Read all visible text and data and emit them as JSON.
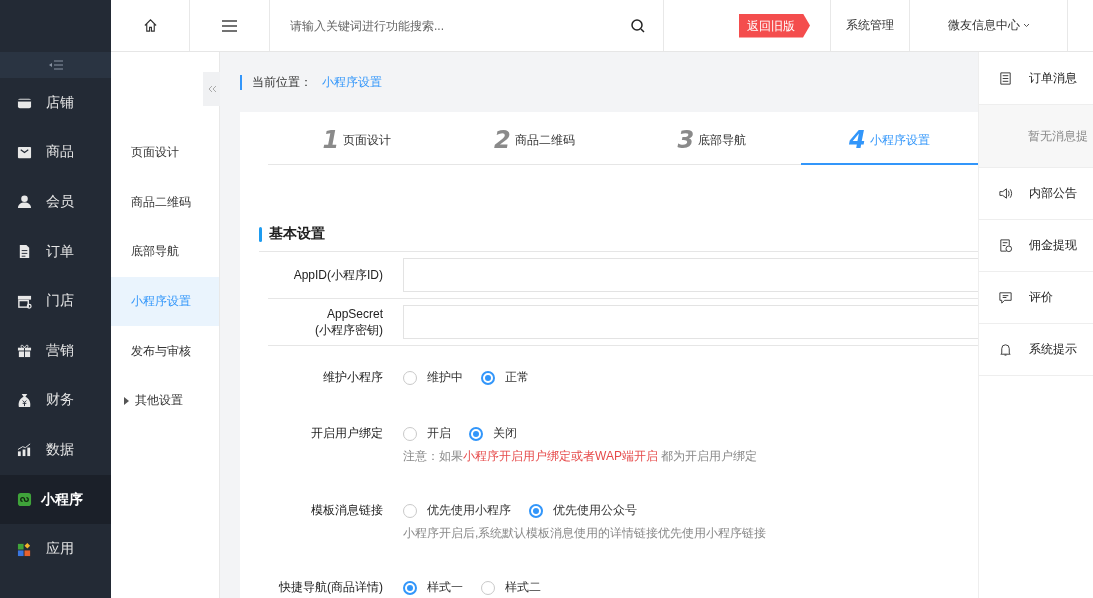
{
  "sidebar": {
    "items": [
      {
        "label": "店铺",
        "selected": false
      },
      {
        "label": "商品",
        "selected": false
      },
      {
        "label": "会员",
        "selected": false
      },
      {
        "label": "订单",
        "selected": false
      },
      {
        "label": "门店",
        "selected": false
      },
      {
        "label": "营销",
        "selected": false
      },
      {
        "label": "财务",
        "selected": false
      },
      {
        "label": "数据",
        "selected": false
      },
      {
        "label": "小程序",
        "selected": true
      },
      {
        "label": "应用",
        "selected": false
      }
    ]
  },
  "topbar": {
    "search": {
      "placeholder": "请输入关键词进行功能搜索..."
    },
    "badge": "返回旧版",
    "links": [
      "系统管理"
    ],
    "account": "微友信息中心"
  },
  "subnav": {
    "items": [
      {
        "kind": "item",
        "label": "页面设计",
        "selected": false
      },
      {
        "kind": "item",
        "label": "商品二维码",
        "selected": false
      },
      {
        "kind": "item",
        "label": "底部导航",
        "selected": false
      },
      {
        "kind": "item",
        "label": "小程序设置",
        "selected": true
      },
      {
        "kind": "item",
        "label": "发布与审核",
        "selected": false
      },
      {
        "kind": "group",
        "label": "其他设置",
        "expanded": false
      }
    ]
  },
  "breadcrumb": {
    "label": "当前位置：",
    "current": "小程序设置"
  },
  "steps": [
    {
      "number": "1",
      "label": "页面设计",
      "selected": false
    },
    {
      "number": "2",
      "label": "商品二维码",
      "selected": false
    },
    {
      "number": "3",
      "label": "底部导航",
      "selected": false
    },
    {
      "number": "4",
      "label": "小程序设置",
      "selected": true
    }
  ],
  "section_title": "基本设置",
  "fields": [
    {
      "kind": "input",
      "label": "AppID(小程序ID)"
    },
    {
      "kind": "input",
      "label": "AppSecret",
      "sublabel": "(小程序密钥)"
    },
    {
      "kind": "radio",
      "label": "维护小程序",
      "options": [
        {
          "label": "维护中",
          "selected": false
        },
        {
          "label": "正常",
          "selected": true
        }
      ]
    },
    {
      "kind": "radio",
      "label": "开启用户绑定",
      "options": [
        {
          "label": "开启",
          "selected": false
        },
        {
          "label": "关闭",
          "selected": true
        }
      ],
      "note": [
        {
          "kind": "plain",
          "text": "注意：如果"
        },
        {
          "kind": "highlight",
          "text": "小程序开启用户绑定或者WAP端开启"
        },
        {
          "kind": "plain",
          "text": " 都为开启用户绑定"
        }
      ]
    },
    {
      "kind": "radio",
      "label": "模板消息链接",
      "options": [
        {
          "label": "优先使用小程序",
          "selected": false
        },
        {
          "label": "优先使用公众号",
          "selected": true
        }
      ],
      "note": [
        {
          "kind": "plain",
          "text": "小程序开启后,系统默认模板消息使用的详情链接优先使用小程序链接"
        }
      ]
    },
    {
      "kind": "radio",
      "label": "快捷导航(商品详情)",
      "options": [
        {
          "label": "样式一",
          "selected": true
        },
        {
          "label": "样式二",
          "selected": false
        }
      ]
    }
  ],
  "notifications": {
    "header": "订单消息",
    "empty": "暂无消息提",
    "items": [
      {
        "label": "内部公告"
      },
      {
        "label": "佣金提现"
      },
      {
        "label": "评价"
      },
      {
        "label": "系统提示"
      }
    ]
  }
}
